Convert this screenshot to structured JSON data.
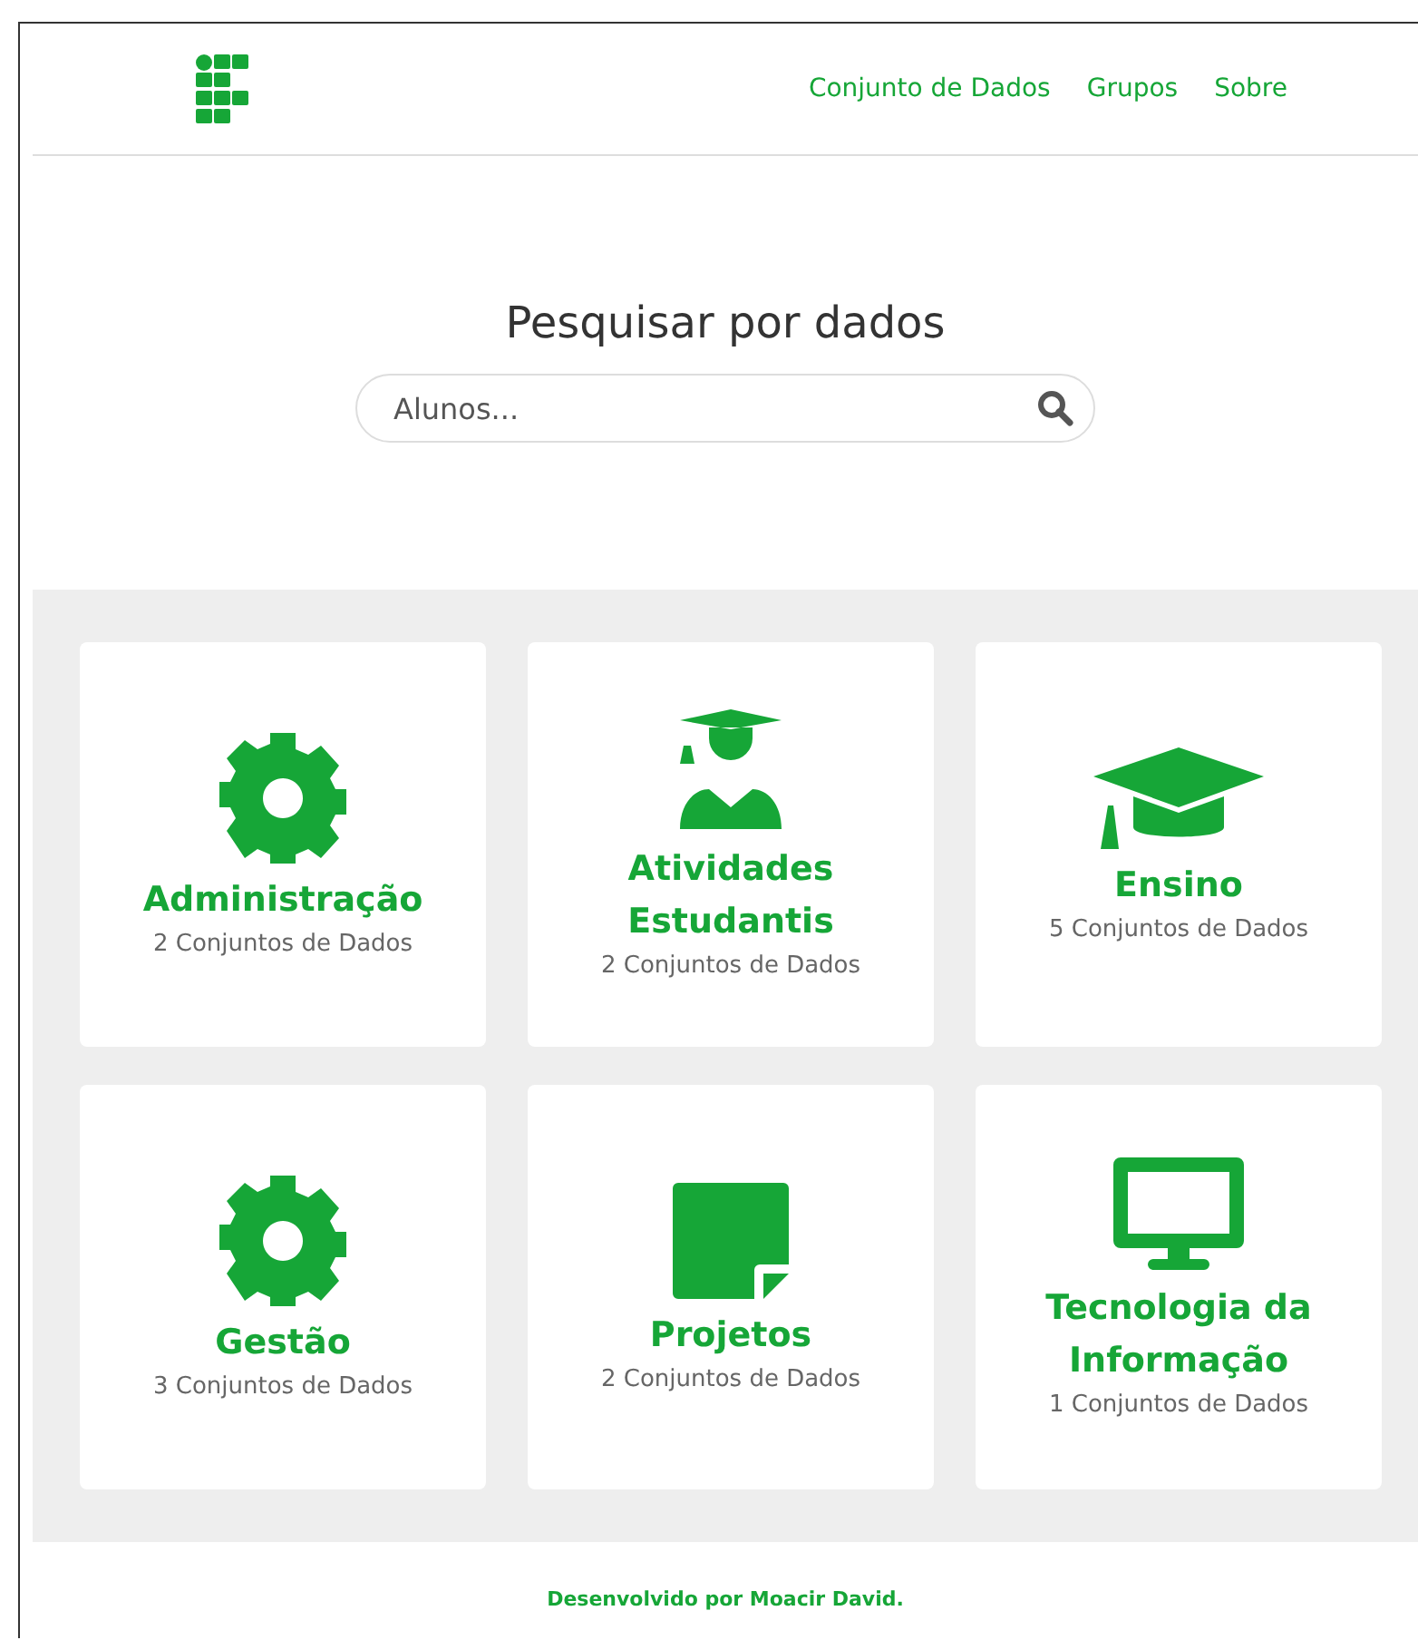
{
  "nav": [
    "Conjunto de Dados",
    "Grupos",
    "Sobre"
  ],
  "search": {
    "title": "Pesquisar por dados",
    "placeholder": "Alunos..."
  },
  "groups": [
    {
      "kind": "gear",
      "name": "Administração",
      "count": "2 Conjuntos de Dados"
    },
    {
      "kind": "graduate",
      "name": "Atividades Estudantis",
      "count": "2 Conjuntos de Dados"
    },
    {
      "kind": "cap",
      "name": "Ensino",
      "count": "5 Conjuntos de Dados"
    },
    {
      "kind": "gear",
      "name": "Gestão",
      "count": "3 Conjuntos de Dados"
    },
    {
      "kind": "document",
      "name": "Projetos",
      "count": "2 Conjuntos de Dados"
    },
    {
      "kind": "monitor",
      "name": "Tecnologia da Informação",
      "count": "1 Conjuntos de Dados"
    }
  ],
  "footer": "Desenvolvido por Moacir David."
}
